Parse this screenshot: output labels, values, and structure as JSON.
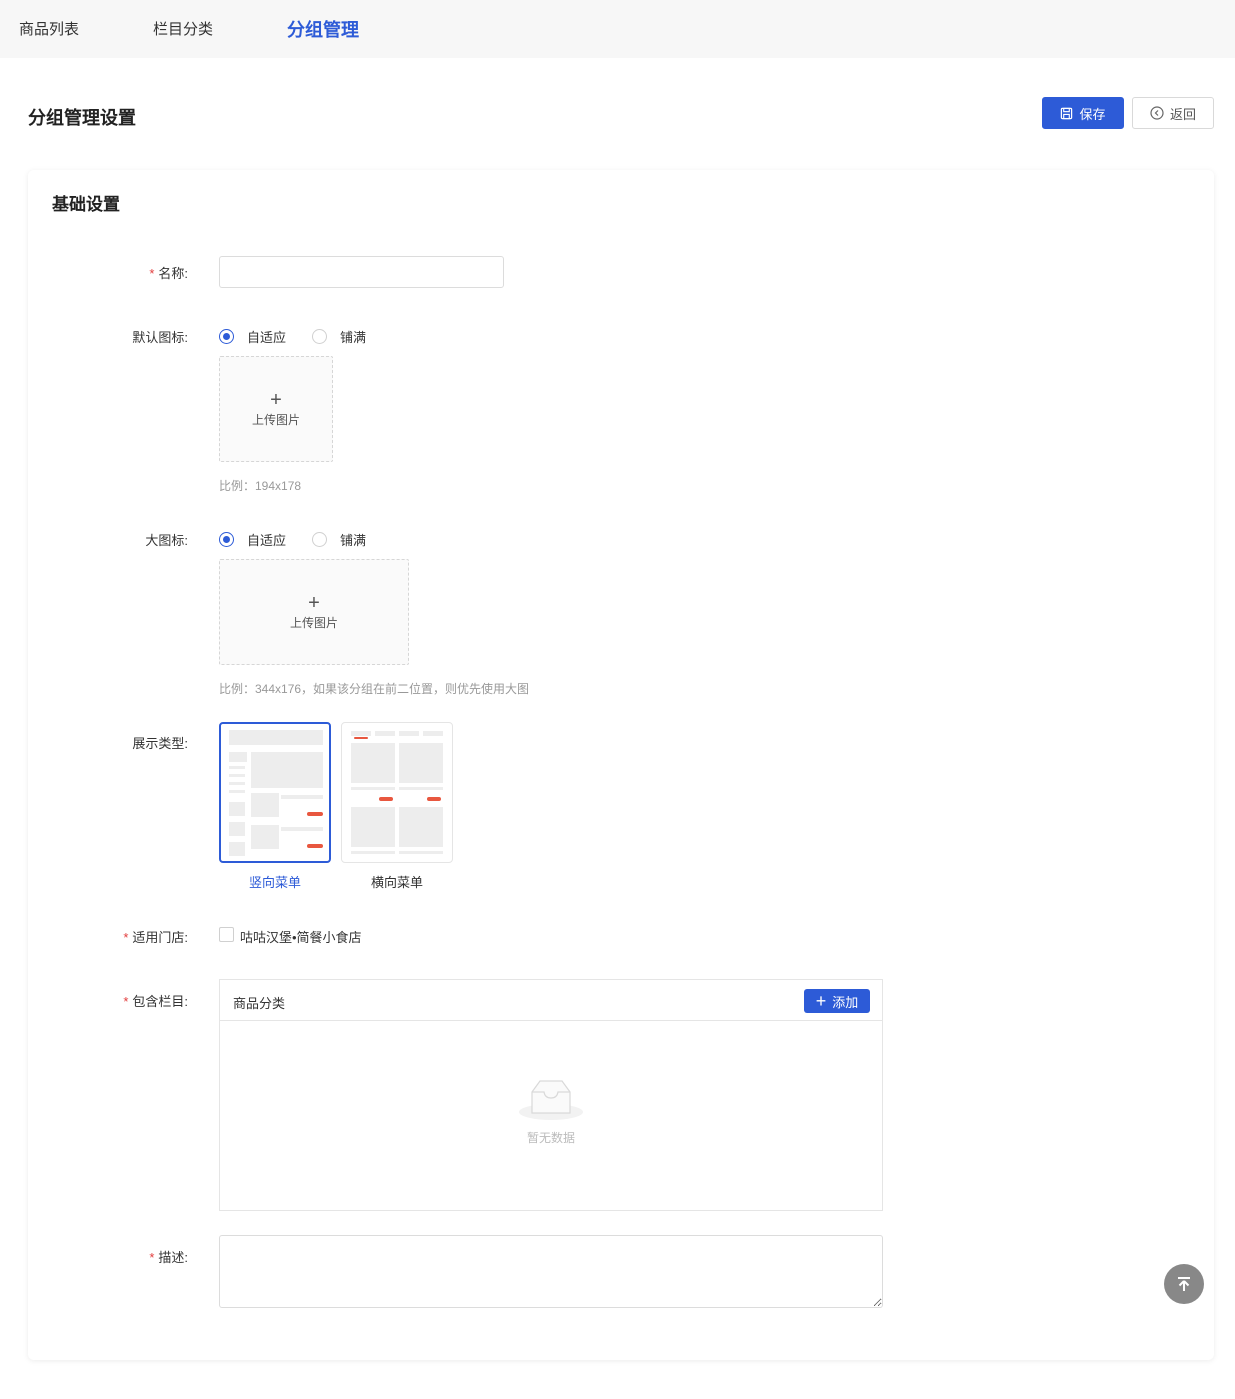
{
  "tabs": [
    {
      "label": "商品列表",
      "active": false
    },
    {
      "label": "栏目分类",
      "active": false
    },
    {
      "label": "分组管理",
      "active": true
    }
  ],
  "page_title": "分组管理设置",
  "actions": {
    "save_label": "保存",
    "back_label": "返回"
  },
  "section_title": "基础设置",
  "form": {
    "name": {
      "label": "名称:",
      "required": true,
      "value": ""
    },
    "default_icon": {
      "label": "默认图标:",
      "options": [
        "自适应",
        "铺满"
      ],
      "selected": "自适应",
      "upload_label": "上传图片",
      "hint": "比例：194x178"
    },
    "large_icon": {
      "label": "大图标:",
      "options": [
        "自适应",
        "铺满"
      ],
      "selected": "自适应",
      "upload_label": "上传图片",
      "hint": "比例：344x176，如果该分组在前二位置，则优先使用大图"
    },
    "display_type": {
      "label": "展示类型:",
      "options": [
        "竖向菜单",
        "横向菜单"
      ],
      "selected": "竖向菜单"
    },
    "stores": {
      "label": "适用门店:",
      "required": true,
      "option": "咕咕汉堡•简餐小食店",
      "checked": false
    },
    "columns": {
      "label": "包含栏目:",
      "required": true,
      "header": "商品分类",
      "add_label": "添加",
      "empty_text": "暂无数据"
    },
    "description": {
      "label": "描述:",
      "required": true,
      "value": ""
    }
  },
  "colors": {
    "primary": "#2d5bd7",
    "required": "#e23c3c",
    "accent_red": "#e8573f"
  }
}
